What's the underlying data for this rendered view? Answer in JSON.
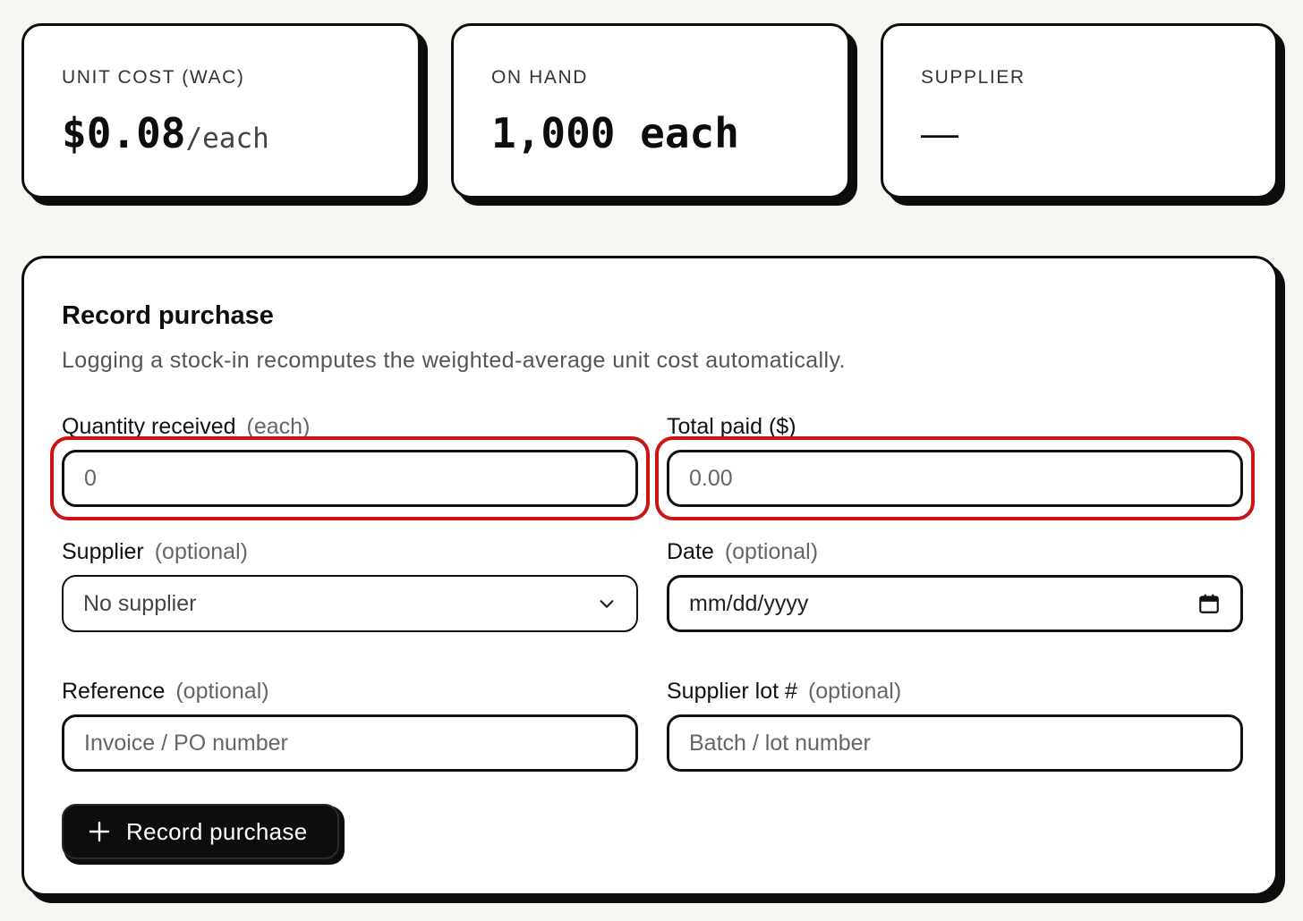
{
  "stats": {
    "unit_cost": {
      "label": "UNIT COST (WAC)",
      "value": "$0.08",
      "unit": "/each"
    },
    "on_hand": {
      "label": "ON HAND",
      "value": "1,000 each"
    },
    "supplier": {
      "label": "SUPPLIER",
      "value": "—"
    }
  },
  "form": {
    "title": "Record purchase",
    "description": "Logging a stock-in recomputes the weighted-average unit cost automatically.",
    "quantity": {
      "label": "Quantity received",
      "hint": "(each)",
      "placeholder": "0"
    },
    "total_paid": {
      "label": "Total paid ($)",
      "placeholder": "0.00"
    },
    "supplier": {
      "label": "Supplier",
      "hint": "(optional)",
      "selected": "No supplier"
    },
    "date": {
      "label": "Date",
      "hint": "(optional)",
      "value": "mm/dd/yyyy"
    },
    "reference": {
      "label": "Reference",
      "hint": "(optional)",
      "placeholder": "Invoice / PO number"
    },
    "supplier_lot": {
      "label": "Supplier lot #",
      "hint": "(optional)",
      "placeholder": "Batch / lot number"
    },
    "submit_label": "Record purchase"
  },
  "colors": {
    "accent": "#0d0d0d",
    "focus_ring": "#cc1414",
    "background": "#f7f6f3"
  },
  "icons": {
    "select": "chevron-down-icon",
    "date": "calendar-icon",
    "submit": "plus-icon"
  }
}
